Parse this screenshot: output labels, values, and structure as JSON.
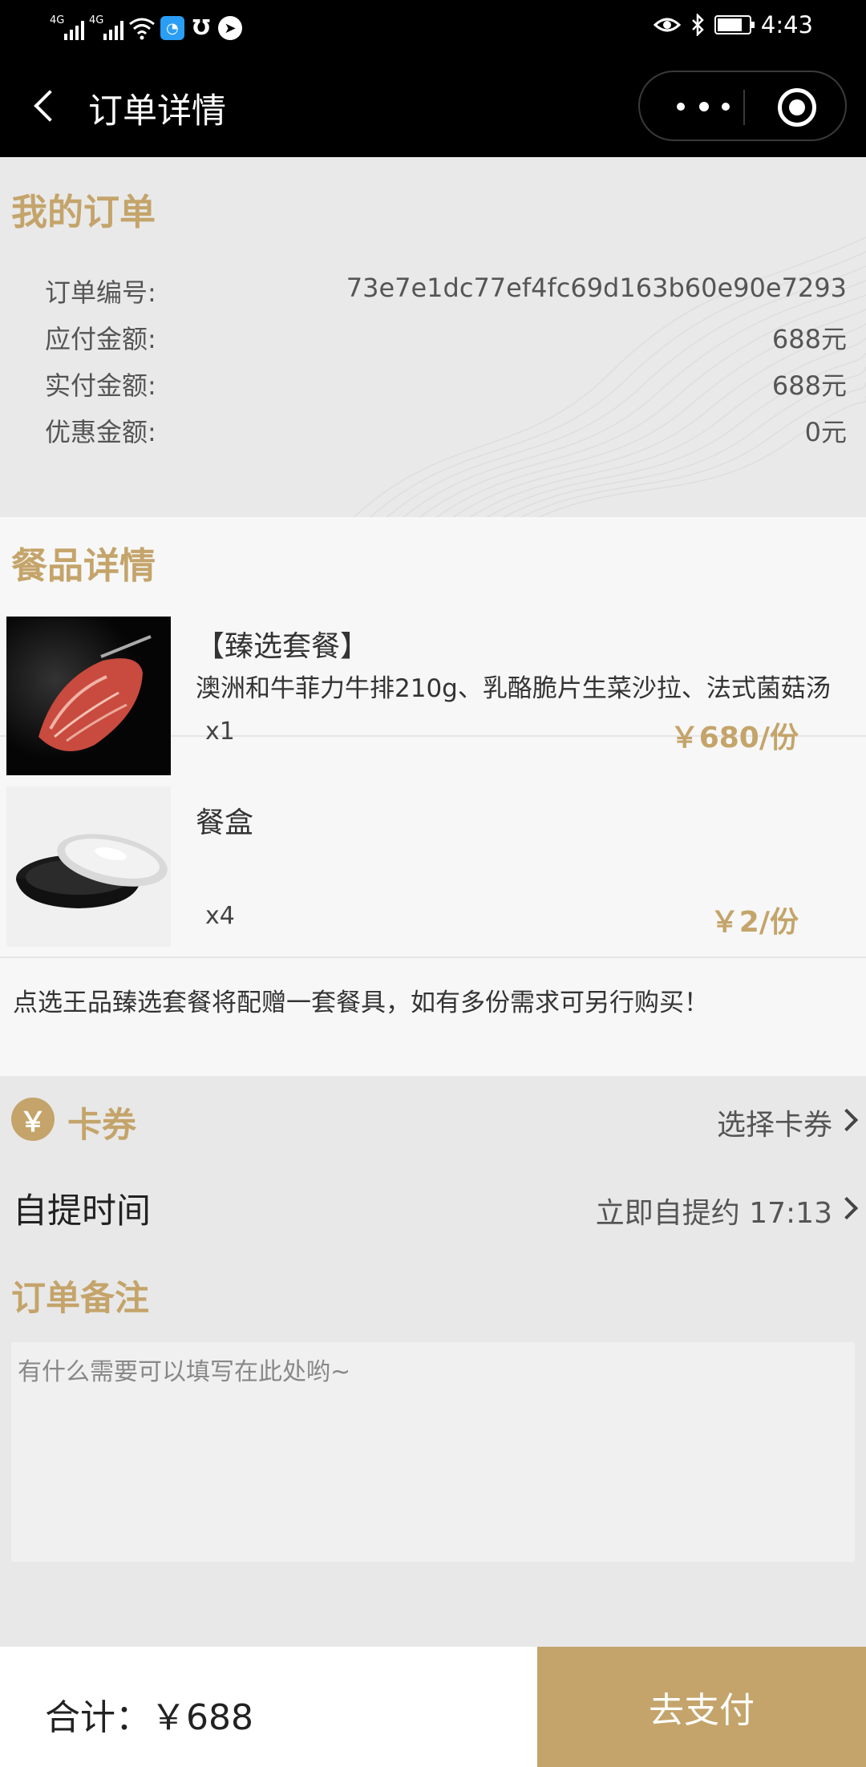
{
  "status_bar": {
    "network_1": "4G",
    "network_2": "4G",
    "time": "4:43",
    "icons": [
      "signal-icon",
      "signal-icon",
      "wifi-icon",
      "app-notification-icon",
      "app-notification-icon",
      "app-notification-icon",
      "eye-icon",
      "bluetooth-icon",
      "battery-icon"
    ]
  },
  "nav": {
    "title": "订单详情"
  },
  "order": {
    "title": "我的订单",
    "rows": [
      {
        "label": "订单编号:",
        "value": "73e7e1dc77ef4fc69d163b60e90e7293"
      },
      {
        "label": "应付金额:",
        "value": "688元"
      },
      {
        "label": "实付金额:",
        "value": "688元"
      },
      {
        "label": "优惠金额:",
        "value": "0元"
      }
    ]
  },
  "food": {
    "title": "餐品详情",
    "items": [
      {
        "name": "【臻选套餐】",
        "desc": "澳洲和牛菲力牛排210g、乳酪脆片生菜沙拉、法式菌菇汤",
        "qty": "x1",
        "price": "￥680/份"
      },
      {
        "name": "餐盒",
        "desc": "",
        "qty": "x4",
        "price": "￥2/份"
      }
    ],
    "note": "点选王品臻选套餐将配赠一套餐具，如有多份需求可另行购买！"
  },
  "coupon": {
    "icon": "￥",
    "label": "卡券",
    "action": "选择卡券"
  },
  "pickup": {
    "label": "自提时间",
    "value": "立即自提约 17:13"
  },
  "remark": {
    "title": "订单备注",
    "placeholder": "有什么需要可以填写在此处哟~"
  },
  "footer": {
    "total": "合计：￥688",
    "pay_label": "去支付"
  },
  "colors": {
    "accent": "#c4a46a",
    "bar": "#000000",
    "page": "#e8e8e8"
  }
}
